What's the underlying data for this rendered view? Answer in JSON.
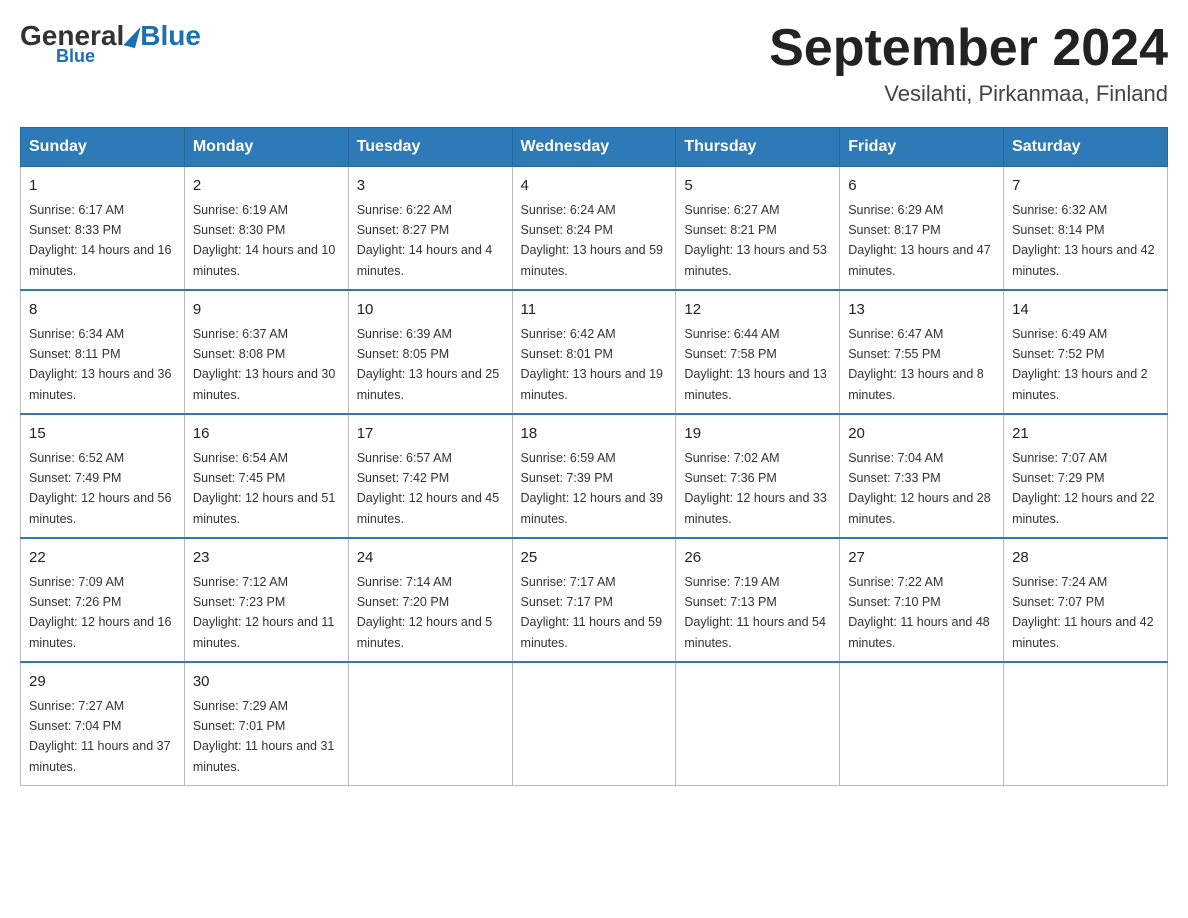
{
  "header": {
    "logo_general": "General",
    "logo_blue": "Blue",
    "month_title": "September 2024",
    "location": "Vesilahti, Pirkanmaa, Finland"
  },
  "weekdays": [
    "Sunday",
    "Monday",
    "Tuesday",
    "Wednesday",
    "Thursday",
    "Friday",
    "Saturday"
  ],
  "weeks": [
    [
      {
        "day": "1",
        "sunrise": "6:17 AM",
        "sunset": "8:33 PM",
        "daylight": "14 hours and 16 minutes."
      },
      {
        "day": "2",
        "sunrise": "6:19 AM",
        "sunset": "8:30 PM",
        "daylight": "14 hours and 10 minutes."
      },
      {
        "day": "3",
        "sunrise": "6:22 AM",
        "sunset": "8:27 PM",
        "daylight": "14 hours and 4 minutes."
      },
      {
        "day": "4",
        "sunrise": "6:24 AM",
        "sunset": "8:24 PM",
        "daylight": "13 hours and 59 minutes."
      },
      {
        "day": "5",
        "sunrise": "6:27 AM",
        "sunset": "8:21 PM",
        "daylight": "13 hours and 53 minutes."
      },
      {
        "day": "6",
        "sunrise": "6:29 AM",
        "sunset": "8:17 PM",
        "daylight": "13 hours and 47 minutes."
      },
      {
        "day": "7",
        "sunrise": "6:32 AM",
        "sunset": "8:14 PM",
        "daylight": "13 hours and 42 minutes."
      }
    ],
    [
      {
        "day": "8",
        "sunrise": "6:34 AM",
        "sunset": "8:11 PM",
        "daylight": "13 hours and 36 minutes."
      },
      {
        "day": "9",
        "sunrise": "6:37 AM",
        "sunset": "8:08 PM",
        "daylight": "13 hours and 30 minutes."
      },
      {
        "day": "10",
        "sunrise": "6:39 AM",
        "sunset": "8:05 PM",
        "daylight": "13 hours and 25 minutes."
      },
      {
        "day": "11",
        "sunrise": "6:42 AM",
        "sunset": "8:01 PM",
        "daylight": "13 hours and 19 minutes."
      },
      {
        "day": "12",
        "sunrise": "6:44 AM",
        "sunset": "7:58 PM",
        "daylight": "13 hours and 13 minutes."
      },
      {
        "day": "13",
        "sunrise": "6:47 AM",
        "sunset": "7:55 PM",
        "daylight": "13 hours and 8 minutes."
      },
      {
        "day": "14",
        "sunrise": "6:49 AM",
        "sunset": "7:52 PM",
        "daylight": "13 hours and 2 minutes."
      }
    ],
    [
      {
        "day": "15",
        "sunrise": "6:52 AM",
        "sunset": "7:49 PM",
        "daylight": "12 hours and 56 minutes."
      },
      {
        "day": "16",
        "sunrise": "6:54 AM",
        "sunset": "7:45 PM",
        "daylight": "12 hours and 51 minutes."
      },
      {
        "day": "17",
        "sunrise": "6:57 AM",
        "sunset": "7:42 PM",
        "daylight": "12 hours and 45 minutes."
      },
      {
        "day": "18",
        "sunrise": "6:59 AM",
        "sunset": "7:39 PM",
        "daylight": "12 hours and 39 minutes."
      },
      {
        "day": "19",
        "sunrise": "7:02 AM",
        "sunset": "7:36 PM",
        "daylight": "12 hours and 33 minutes."
      },
      {
        "day": "20",
        "sunrise": "7:04 AM",
        "sunset": "7:33 PM",
        "daylight": "12 hours and 28 minutes."
      },
      {
        "day": "21",
        "sunrise": "7:07 AM",
        "sunset": "7:29 PM",
        "daylight": "12 hours and 22 minutes."
      }
    ],
    [
      {
        "day": "22",
        "sunrise": "7:09 AM",
        "sunset": "7:26 PM",
        "daylight": "12 hours and 16 minutes."
      },
      {
        "day": "23",
        "sunrise": "7:12 AM",
        "sunset": "7:23 PM",
        "daylight": "12 hours and 11 minutes."
      },
      {
        "day": "24",
        "sunrise": "7:14 AM",
        "sunset": "7:20 PM",
        "daylight": "12 hours and 5 minutes."
      },
      {
        "day": "25",
        "sunrise": "7:17 AM",
        "sunset": "7:17 PM",
        "daylight": "11 hours and 59 minutes."
      },
      {
        "day": "26",
        "sunrise": "7:19 AM",
        "sunset": "7:13 PM",
        "daylight": "11 hours and 54 minutes."
      },
      {
        "day": "27",
        "sunrise": "7:22 AM",
        "sunset": "7:10 PM",
        "daylight": "11 hours and 48 minutes."
      },
      {
        "day": "28",
        "sunrise": "7:24 AM",
        "sunset": "7:07 PM",
        "daylight": "11 hours and 42 minutes."
      }
    ],
    [
      {
        "day": "29",
        "sunrise": "7:27 AM",
        "sunset": "7:04 PM",
        "daylight": "11 hours and 37 minutes."
      },
      {
        "day": "30",
        "sunrise": "7:29 AM",
        "sunset": "7:01 PM",
        "daylight": "11 hours and 31 minutes."
      },
      null,
      null,
      null,
      null,
      null
    ]
  ]
}
